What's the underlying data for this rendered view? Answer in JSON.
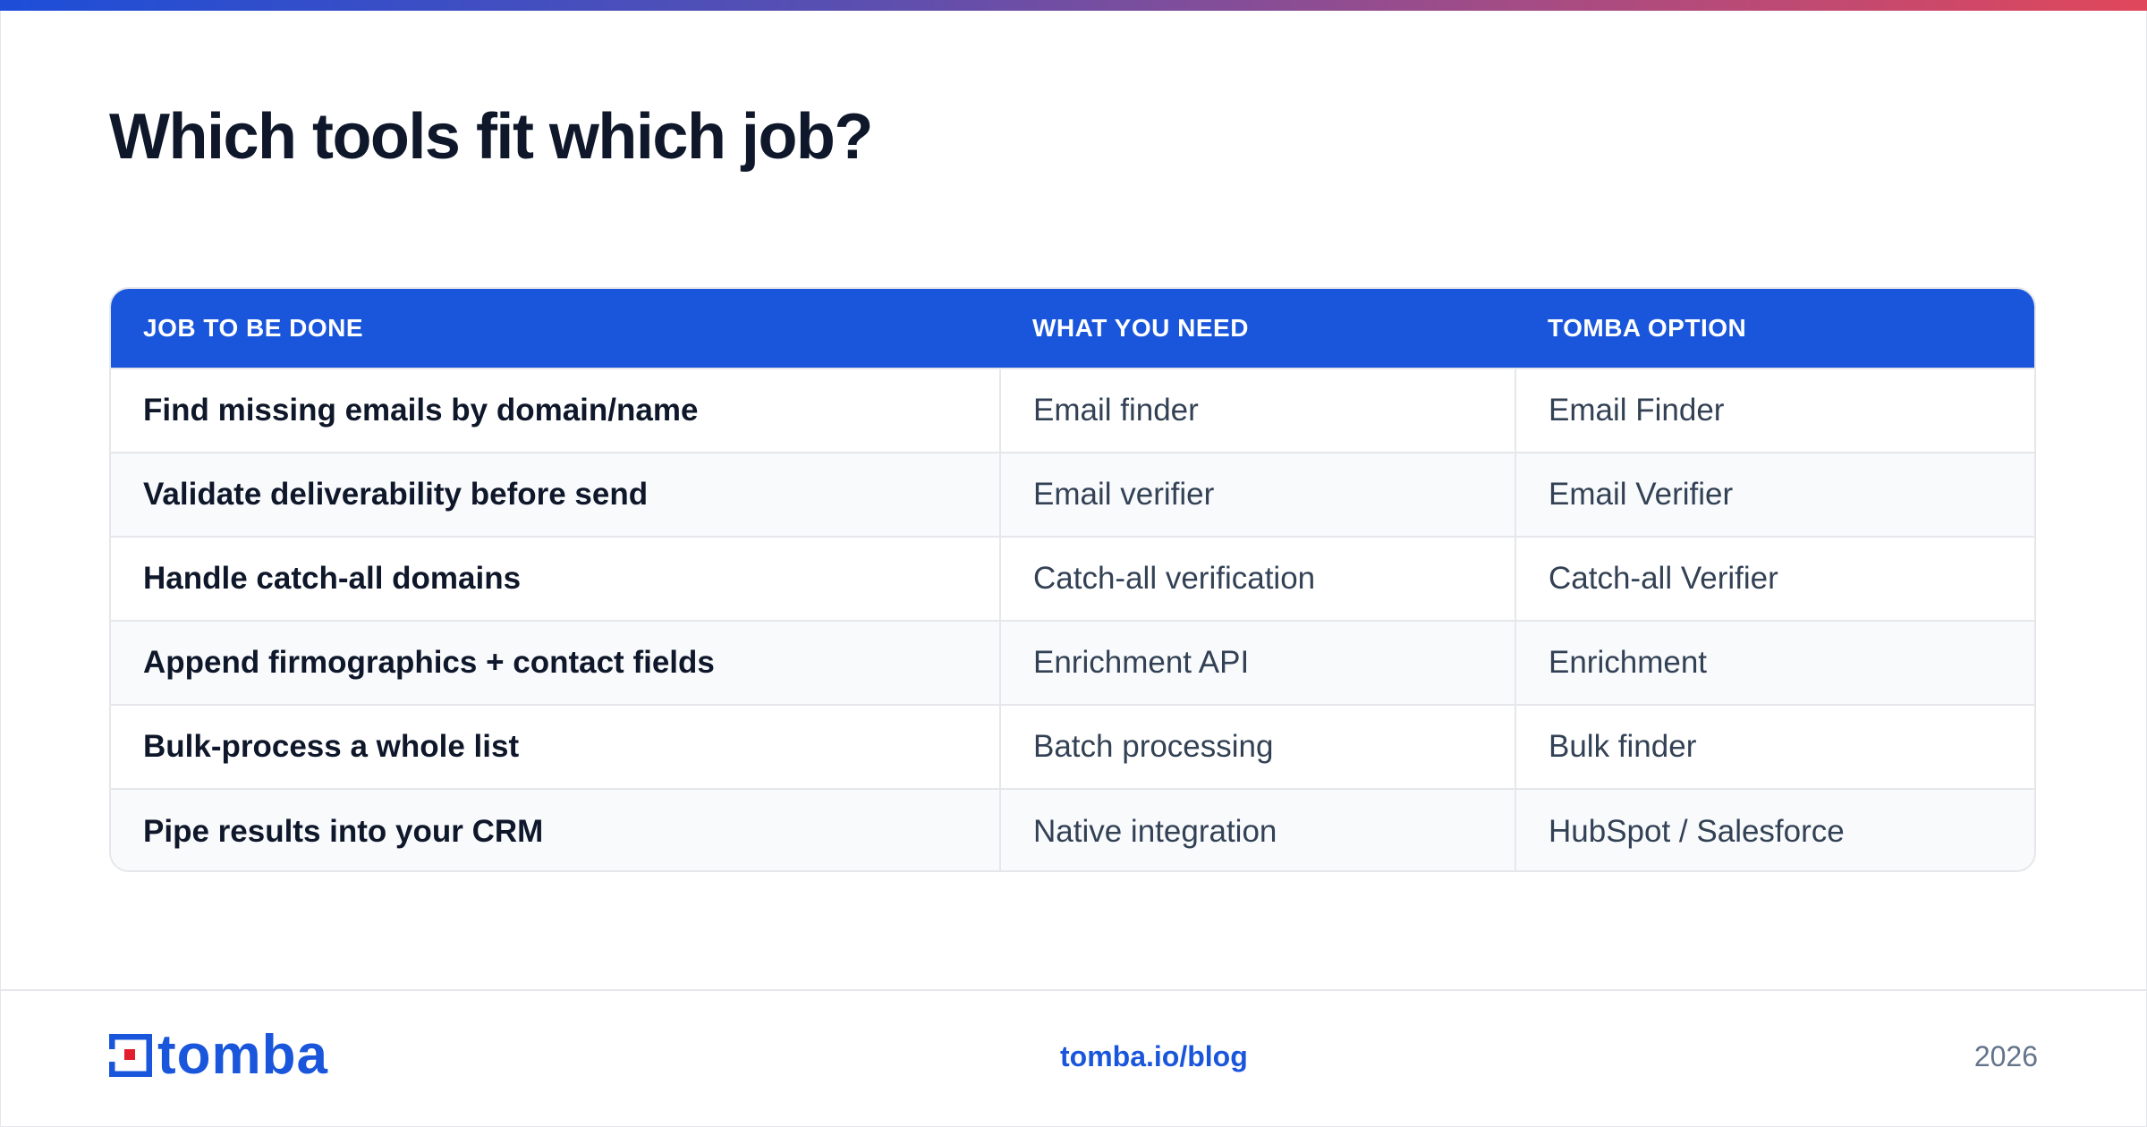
{
  "title": "Which tools fit which job?",
  "table": {
    "headers": [
      "JOB TO BE DONE",
      "WHAT YOU NEED",
      "TOMBA OPTION"
    ],
    "rows": [
      [
        "Find missing emails by domain/name",
        "Email finder",
        "Email Finder"
      ],
      [
        "Validate deliverability before send",
        "Email verifier",
        "Email Verifier"
      ],
      [
        "Handle catch-all domains",
        "Catch-all verification",
        "Catch-all Verifier"
      ],
      [
        "Append firmographics + contact fields",
        "Enrichment API",
        "Enrichment"
      ],
      [
        "Bulk-process a whole list",
        "Batch processing",
        "Bulk finder"
      ],
      [
        "Pipe results into your CRM",
        "Native integration",
        "HubSpot / Salesforce"
      ]
    ]
  },
  "footer": {
    "logo_text": "tomba",
    "link": "tomba.io/blog",
    "year": "2026"
  },
  "colors": {
    "accent": "#1a56db",
    "logo_red": "#e11d2e",
    "title": "#0f172a",
    "muted": "#64748b"
  },
  "icons": {
    "logo": "tomba-logo-icon"
  }
}
